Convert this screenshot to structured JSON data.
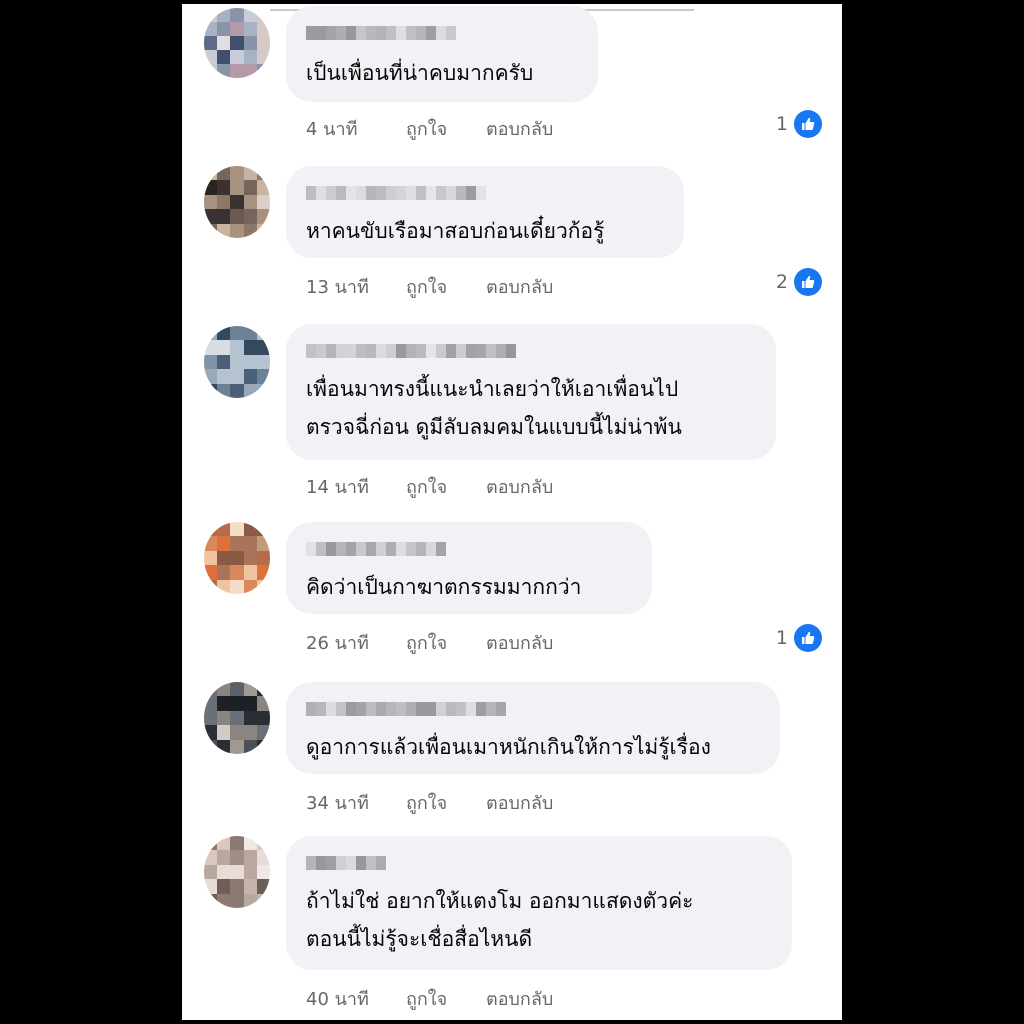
{
  "actions": {
    "like_label": "ถูกใจ",
    "reply_label": "ตอบกลับ"
  },
  "colors": {
    "bubble": "#f0f2f5",
    "meta_text": "#65676b",
    "like_blue": "#1877f2"
  },
  "comments": [
    {
      "text": "เป็นเพื่อนที่น่าคบมากครับ",
      "time": "4 นาที",
      "reactions": "1",
      "reaction_icon": "like-thumb-icon"
    },
    {
      "text": "หาคนขับเรือมาสอบก่อนเดี๋ยวก้อรู้",
      "time": "13 นาที",
      "reactions": "2",
      "reaction_icon": "like-thumb-icon"
    },
    {
      "text": "เพื่อนมาทรงนี้แนะนำเลยว่าให้เอาเพื่อนไป\nตรวจฉี่ก่อน ดูมีลับลมคมในแบบนี้ไม่น่าพ้น",
      "time": "14 นาที"
    },
    {
      "text": "คิดว่าเป็นกาฆาตกรรมมากกว่า",
      "time": "26 นาที",
      "reactions": "1",
      "reaction_icon": "like-thumb-icon"
    },
    {
      "text": "ดูอาการแล้วเพื่อนเมาหนักเกินให้การไม่รู้เรื่อง",
      "time": "34 นาที"
    },
    {
      "text": "ถ้าไม่ใช่ อยากให้แตงโม ออกมาแสดงตัวค่ะ\nตอนนี้ไม่รู้จะเชื่อสื่อไหนดี",
      "time": "40 นาที"
    }
  ]
}
